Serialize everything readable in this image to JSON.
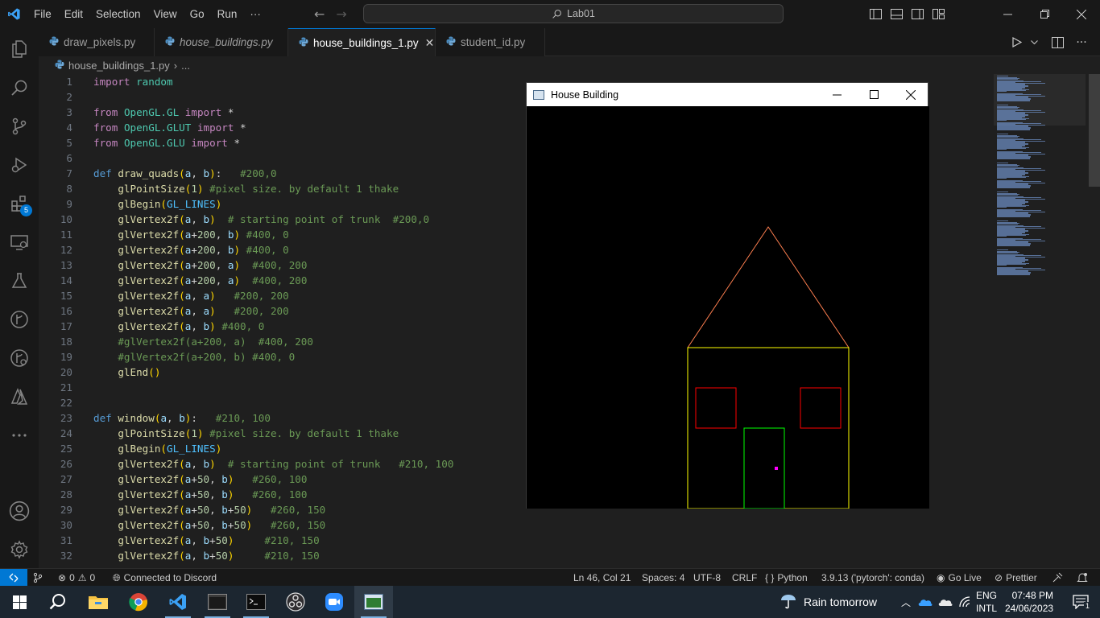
{
  "menu": [
    "File",
    "Edit",
    "Selection",
    "View",
    "Go",
    "Run",
    "···"
  ],
  "command_center": "Lab01",
  "tabs": [
    {
      "label": "draw_pixels.py",
      "italic": false,
      "active": false
    },
    {
      "label": "house_buildings.py",
      "italic": true,
      "active": false
    },
    {
      "label": "house_buildings_1.py",
      "italic": false,
      "active": true
    },
    {
      "label": "student_id.py",
      "italic": false,
      "active": false
    }
  ],
  "breadcrumb": {
    "file": "house_buildings_1.py",
    "rest": "..."
  },
  "activity_badge": "5",
  "code": [
    {
      "n": "1",
      "segs": [
        [
          "t-imp",
          "import"
        ],
        [
          "t-plain",
          " "
        ],
        [
          "t-mod",
          "random"
        ]
      ]
    },
    {
      "n": "2",
      "segs": []
    },
    {
      "n": "3",
      "segs": [
        [
          "t-imp",
          "from"
        ],
        [
          "t-plain",
          " "
        ],
        [
          "t-mod",
          "OpenGL.GL"
        ],
        [
          "t-plain",
          " "
        ],
        [
          "t-imp",
          "import"
        ],
        [
          "t-plain",
          " *"
        ]
      ]
    },
    {
      "n": "4",
      "segs": [
        [
          "t-imp",
          "from"
        ],
        [
          "t-plain",
          " "
        ],
        [
          "t-mod",
          "OpenGL.GLUT"
        ],
        [
          "t-plain",
          " "
        ],
        [
          "t-imp",
          "import"
        ],
        [
          "t-plain",
          " *"
        ]
      ]
    },
    {
      "n": "5",
      "segs": [
        [
          "t-imp",
          "from"
        ],
        [
          "t-plain",
          " "
        ],
        [
          "t-mod",
          "OpenGL.GLU"
        ],
        [
          "t-plain",
          " "
        ],
        [
          "t-imp",
          "import"
        ],
        [
          "t-plain",
          " *"
        ]
      ]
    },
    {
      "n": "6",
      "segs": []
    },
    {
      "n": "7",
      "segs": [
        [
          "t-kw",
          "def"
        ],
        [
          "t-plain",
          " "
        ],
        [
          "t-fn",
          "draw_quads"
        ],
        [
          "t-par",
          "("
        ],
        [
          "t-var",
          "a"
        ],
        [
          "t-plain",
          ", "
        ],
        [
          "t-var",
          "b"
        ],
        [
          "t-par",
          ")"
        ],
        [
          "t-plain",
          ":   "
        ],
        [
          "t-com",
          "#200,0"
        ]
      ]
    },
    {
      "n": "8",
      "segs": [
        [
          "t-plain",
          "    "
        ],
        [
          "t-fn",
          "glPointSize"
        ],
        [
          "t-par",
          "("
        ],
        [
          "t-num",
          "1"
        ],
        [
          "t-par",
          ")"
        ],
        [
          "t-plain",
          " "
        ],
        [
          "t-com",
          "#pixel size. by default 1 thake"
        ]
      ]
    },
    {
      "n": "9",
      "segs": [
        [
          "t-plain",
          "    "
        ],
        [
          "t-fn",
          "glBegin"
        ],
        [
          "t-par",
          "("
        ],
        [
          "t-const",
          "GL_LINES"
        ],
        [
          "t-par",
          ")"
        ]
      ]
    },
    {
      "n": "10",
      "segs": [
        [
          "t-plain",
          "    "
        ],
        [
          "t-fn",
          "glVertex2f"
        ],
        [
          "t-par",
          "("
        ],
        [
          "t-var",
          "a"
        ],
        [
          "t-plain",
          ", "
        ],
        [
          "t-var",
          "b"
        ],
        [
          "t-par",
          ")"
        ],
        [
          "t-plain",
          "  "
        ],
        [
          "t-com",
          "# starting point of trunk  #200,0"
        ]
      ]
    },
    {
      "n": "11",
      "segs": [
        [
          "t-plain",
          "    "
        ],
        [
          "t-fn",
          "glVertex2f"
        ],
        [
          "t-par",
          "("
        ],
        [
          "t-var",
          "a"
        ],
        [
          "t-plain",
          "+"
        ],
        [
          "t-num",
          "200"
        ],
        [
          "t-plain",
          ", "
        ],
        [
          "t-var",
          "b"
        ],
        [
          "t-par",
          ")"
        ],
        [
          "t-plain",
          " "
        ],
        [
          "t-com",
          "#400, 0"
        ]
      ]
    },
    {
      "n": "12",
      "segs": [
        [
          "t-plain",
          "    "
        ],
        [
          "t-fn",
          "glVertex2f"
        ],
        [
          "t-par",
          "("
        ],
        [
          "t-var",
          "a"
        ],
        [
          "t-plain",
          "+"
        ],
        [
          "t-num",
          "200"
        ],
        [
          "t-plain",
          ", "
        ],
        [
          "t-var",
          "b"
        ],
        [
          "t-par",
          ")"
        ],
        [
          "t-plain",
          " "
        ],
        [
          "t-com",
          "#400, 0"
        ]
      ]
    },
    {
      "n": "13",
      "segs": [
        [
          "t-plain",
          "    "
        ],
        [
          "t-fn",
          "glVertex2f"
        ],
        [
          "t-par",
          "("
        ],
        [
          "t-var",
          "a"
        ],
        [
          "t-plain",
          "+"
        ],
        [
          "t-num",
          "200"
        ],
        [
          "t-plain",
          ", "
        ],
        [
          "t-var",
          "a"
        ],
        [
          "t-par",
          ")"
        ],
        [
          "t-plain",
          "  "
        ],
        [
          "t-com",
          "#400, 200"
        ]
      ]
    },
    {
      "n": "14",
      "segs": [
        [
          "t-plain",
          "    "
        ],
        [
          "t-fn",
          "glVertex2f"
        ],
        [
          "t-par",
          "("
        ],
        [
          "t-var",
          "a"
        ],
        [
          "t-plain",
          "+"
        ],
        [
          "t-num",
          "200"
        ],
        [
          "t-plain",
          ", "
        ],
        [
          "t-var",
          "a"
        ],
        [
          "t-par",
          ")"
        ],
        [
          "t-plain",
          "  "
        ],
        [
          "t-com",
          "#400, 200"
        ]
      ]
    },
    {
      "n": "15",
      "segs": [
        [
          "t-plain",
          "    "
        ],
        [
          "t-fn",
          "glVertex2f"
        ],
        [
          "t-par",
          "("
        ],
        [
          "t-var",
          "a"
        ],
        [
          "t-plain",
          ", "
        ],
        [
          "t-var",
          "a"
        ],
        [
          "t-par",
          ")"
        ],
        [
          "t-plain",
          "   "
        ],
        [
          "t-com",
          "#200, 200"
        ]
      ]
    },
    {
      "n": "16",
      "segs": [
        [
          "t-plain",
          "    "
        ],
        [
          "t-fn",
          "glVertex2f"
        ],
        [
          "t-par",
          "("
        ],
        [
          "t-var",
          "a"
        ],
        [
          "t-plain",
          ", "
        ],
        [
          "t-var",
          "a"
        ],
        [
          "t-par",
          ")"
        ],
        [
          "t-plain",
          "   "
        ],
        [
          "t-com",
          "#200, 200"
        ]
      ]
    },
    {
      "n": "17",
      "segs": [
        [
          "t-plain",
          "    "
        ],
        [
          "t-fn",
          "glVertex2f"
        ],
        [
          "t-par",
          "("
        ],
        [
          "t-var",
          "a"
        ],
        [
          "t-plain",
          ", "
        ],
        [
          "t-var",
          "b"
        ],
        [
          "t-par",
          ")"
        ],
        [
          "t-plain",
          " "
        ],
        [
          "t-com",
          "#400, 0"
        ]
      ]
    },
    {
      "n": "18",
      "segs": [
        [
          "t-plain",
          "    "
        ],
        [
          "t-com",
          "#glVertex2f(a+200, a)  #400, 200"
        ]
      ]
    },
    {
      "n": "19",
      "segs": [
        [
          "t-plain",
          "    "
        ],
        [
          "t-com",
          "#glVertex2f(a+200, b) #400, 0"
        ]
      ]
    },
    {
      "n": "20",
      "segs": [
        [
          "t-plain",
          "    "
        ],
        [
          "t-fn",
          "glEnd"
        ],
        [
          "t-par",
          "()"
        ]
      ]
    },
    {
      "n": "21",
      "segs": []
    },
    {
      "n": "22",
      "segs": []
    },
    {
      "n": "23",
      "segs": [
        [
          "t-kw",
          "def"
        ],
        [
          "t-plain",
          " "
        ],
        [
          "t-fn",
          "window"
        ],
        [
          "t-par",
          "("
        ],
        [
          "t-var",
          "a"
        ],
        [
          "t-plain",
          ", "
        ],
        [
          "t-var",
          "b"
        ],
        [
          "t-par",
          ")"
        ],
        [
          "t-plain",
          ":   "
        ],
        [
          "t-com",
          "#210, 100"
        ]
      ]
    },
    {
      "n": "24",
      "segs": [
        [
          "t-plain",
          "    "
        ],
        [
          "t-fn",
          "glPointSize"
        ],
        [
          "t-par",
          "("
        ],
        [
          "t-num",
          "1"
        ],
        [
          "t-par",
          ")"
        ],
        [
          "t-plain",
          " "
        ],
        [
          "t-com",
          "#pixel size. by default 1 thake"
        ]
      ]
    },
    {
      "n": "25",
      "segs": [
        [
          "t-plain",
          "    "
        ],
        [
          "t-fn",
          "glBegin"
        ],
        [
          "t-par",
          "("
        ],
        [
          "t-const",
          "GL_LINES"
        ],
        [
          "t-par",
          ")"
        ]
      ]
    },
    {
      "n": "26",
      "segs": [
        [
          "t-plain",
          "    "
        ],
        [
          "t-fn",
          "glVertex2f"
        ],
        [
          "t-par",
          "("
        ],
        [
          "t-var",
          "a"
        ],
        [
          "t-plain",
          ", "
        ],
        [
          "t-var",
          "b"
        ],
        [
          "t-par",
          ")"
        ],
        [
          "t-plain",
          "  "
        ],
        [
          "t-com",
          "# starting point of trunk   #210, 100"
        ]
      ]
    },
    {
      "n": "27",
      "segs": [
        [
          "t-plain",
          "    "
        ],
        [
          "t-fn",
          "glVertex2f"
        ],
        [
          "t-par",
          "("
        ],
        [
          "t-var",
          "a"
        ],
        [
          "t-plain",
          "+"
        ],
        [
          "t-num",
          "50"
        ],
        [
          "t-plain",
          ", "
        ],
        [
          "t-var",
          "b"
        ],
        [
          "t-par",
          ")"
        ],
        [
          "t-plain",
          "   "
        ],
        [
          "t-com",
          "#260, 100"
        ]
      ]
    },
    {
      "n": "28",
      "segs": [
        [
          "t-plain",
          "    "
        ],
        [
          "t-fn",
          "glVertex2f"
        ],
        [
          "t-par",
          "("
        ],
        [
          "t-var",
          "a"
        ],
        [
          "t-plain",
          "+"
        ],
        [
          "t-num",
          "50"
        ],
        [
          "t-plain",
          ", "
        ],
        [
          "t-var",
          "b"
        ],
        [
          "t-par",
          ")"
        ],
        [
          "t-plain",
          "   "
        ],
        [
          "t-com",
          "#260, 100"
        ]
      ]
    },
    {
      "n": "29",
      "segs": [
        [
          "t-plain",
          "    "
        ],
        [
          "t-fn",
          "glVertex2f"
        ],
        [
          "t-par",
          "("
        ],
        [
          "t-var",
          "a"
        ],
        [
          "t-plain",
          "+"
        ],
        [
          "t-num",
          "50"
        ],
        [
          "t-plain",
          ", "
        ],
        [
          "t-var",
          "b"
        ],
        [
          "t-plain",
          "+"
        ],
        [
          "t-num",
          "50"
        ],
        [
          "t-par",
          ")"
        ],
        [
          "t-plain",
          "   "
        ],
        [
          "t-com",
          "#260, 150"
        ]
      ]
    },
    {
      "n": "30",
      "segs": [
        [
          "t-plain",
          "    "
        ],
        [
          "t-fn",
          "glVertex2f"
        ],
        [
          "t-par",
          "("
        ],
        [
          "t-var",
          "a"
        ],
        [
          "t-plain",
          "+"
        ],
        [
          "t-num",
          "50"
        ],
        [
          "t-plain",
          ", "
        ],
        [
          "t-var",
          "b"
        ],
        [
          "t-plain",
          "+"
        ],
        [
          "t-num",
          "50"
        ],
        [
          "t-par",
          ")"
        ],
        [
          "t-plain",
          "   "
        ],
        [
          "t-com",
          "#260, 150"
        ]
      ]
    },
    {
      "n": "31",
      "segs": [
        [
          "t-plain",
          "    "
        ],
        [
          "t-fn",
          "glVertex2f"
        ],
        [
          "t-par",
          "("
        ],
        [
          "t-var",
          "a"
        ],
        [
          "t-plain",
          ", "
        ],
        [
          "t-var",
          "b"
        ],
        [
          "t-plain",
          "+"
        ],
        [
          "t-num",
          "50"
        ],
        [
          "t-par",
          ")"
        ],
        [
          "t-plain",
          "     "
        ],
        [
          "t-com",
          "#210, 150"
        ]
      ]
    },
    {
      "n": "32",
      "segs": [
        [
          "t-plain",
          "    "
        ],
        [
          "t-fn",
          "glVertex2f"
        ],
        [
          "t-par",
          "("
        ],
        [
          "t-var",
          "a"
        ],
        [
          "t-plain",
          ", "
        ],
        [
          "t-var",
          "b"
        ],
        [
          "t-plain",
          "+"
        ],
        [
          "t-num",
          "50"
        ],
        [
          "t-par",
          ")"
        ],
        [
          "t-plain",
          "     "
        ],
        [
          "t-com",
          "#210, 150"
        ]
      ]
    }
  ],
  "gl_window": {
    "title": "House Building",
    "scene_colors": {
      "roof": "#ff7f50",
      "walls": "#ffff00",
      "windows": "#ff0000",
      "door": "#00ff00",
      "knob": "#ff00ff",
      "background": "#000000"
    }
  },
  "status": {
    "errors": "0",
    "warnings": "0",
    "discord": "Connected to Discord",
    "position": "Ln 46, Col 21",
    "spaces": "Spaces: 4",
    "encoding": "UTF-8",
    "eol": "CRLF",
    "language": "Python",
    "interpreter": "3.9.13 ('pytorch': conda)",
    "golive": "Go Live",
    "prettier": "Prettier"
  },
  "taskbar": {
    "weather": "Rain tomorrow",
    "lang_top": "ENG",
    "lang_bottom": "INTL",
    "time": "07:48 PM",
    "date": "24/06/2023",
    "notifications": "1"
  },
  "colors": {
    "accent": "#0078d4",
    "titlebar": "#181818",
    "editor_bg": "#1f1f1f",
    "taskbar": "#1c2630"
  }
}
